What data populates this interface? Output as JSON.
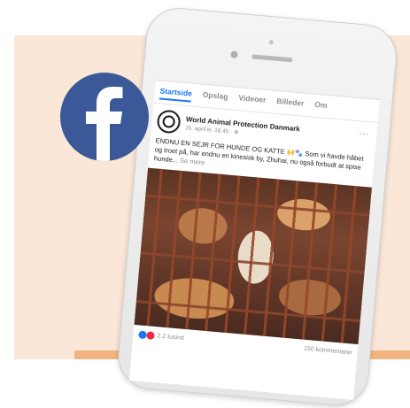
{
  "tabs": [
    "Startside",
    "Opslag",
    "Videoer",
    "Billeder",
    "Om"
  ],
  "post": {
    "page_name": "World Animal Protection Danmark",
    "date": "15. april kl. 16.45 · ⊕",
    "more": "···",
    "text_line": "ENDNU EN SEJR FOR HUNDE OG KATTE 🙌🐾 Som vi havde håbet og troet på, har endnu en kinesisk by, Zhuhai, nu også forbudt at spise hunde...",
    "see_more": "Se mere"
  },
  "reactions": {
    "count": "2,2 tusind",
    "comments": "150 kommentarer"
  },
  "colors": {
    "facebook_blue": "#3b5998",
    "link_blue": "#1877f2",
    "peach": "#fbe7d8"
  },
  "icons": {
    "logo": "facebook-logo-icon",
    "like": "like-icon",
    "love": "love-icon"
  }
}
